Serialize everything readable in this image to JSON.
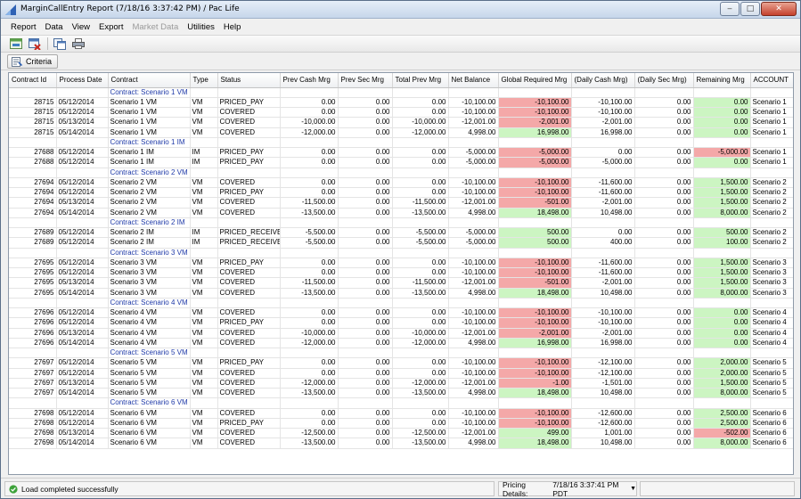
{
  "window": {
    "title": "MarginCallEntry Report (7/18/16 3:37:42 PM) / Pac Life",
    "controls": {
      "minimize": "‒",
      "maximize": "□",
      "close": "✕"
    }
  },
  "menu": [
    {
      "label": "Report",
      "enabled": true
    },
    {
      "label": "Data",
      "enabled": true
    },
    {
      "label": "View",
      "enabled": true
    },
    {
      "label": "Export",
      "enabled": true
    },
    {
      "label": "Market Data",
      "enabled": false
    },
    {
      "label": "Utilities",
      "enabled": true
    },
    {
      "label": "Help",
      "enabled": true
    }
  ],
  "criteria": {
    "label": "Criteria"
  },
  "table": {
    "columns": [
      "Contract Id",
      "Process Date",
      "Contract",
      "Type",
      "Status",
      "Prev Cash Mrg",
      "Prev Sec Mrg",
      "Total Prev Mrg",
      "Net Balance",
      "Global Required Mrg",
      "(Daily Cash Mrg)",
      "(Daily Sec Mrg)",
      "Remaining Mrg",
      "ACCOUNT"
    ],
    "rows": [
      {
        "group": "Contract: Scenario 1 VM"
      },
      {
        "id": "28715",
        "date": "05/12/2014",
        "contract": "Scenario 1 VM",
        "type": "VM",
        "status": "PRICED_PAY",
        "prevCash": "0.00",
        "prevSec": "0.00",
        "totalPrev": "0.00",
        "net": "-10,100.00",
        "globalReq": "-10,100.00",
        "dailyCash": "-10,100.00",
        "dailySec": "0.00",
        "remaining": "0.00",
        "account": "Scenario 1"
      },
      {
        "id": "28715",
        "date": "05/12/2014",
        "contract": "Scenario 1 VM",
        "type": "VM",
        "status": "COVERED",
        "prevCash": "0.00",
        "prevSec": "0.00",
        "totalPrev": "0.00",
        "net": "-10,100.00",
        "globalReq": "-10,100.00",
        "dailyCash": "-10,100.00",
        "dailySec": "0.00",
        "remaining": "0.00",
        "account": "Scenario 1"
      },
      {
        "id": "28715",
        "date": "05/13/2014",
        "contract": "Scenario 1 VM",
        "type": "VM",
        "status": "COVERED",
        "prevCash": "-10,000.00",
        "prevSec": "0.00",
        "totalPrev": "-10,000.00",
        "net": "-12,001.00",
        "globalReq": "-2,001.00",
        "dailyCash": "-2,001.00",
        "dailySec": "0.00",
        "remaining": "0.00",
        "account": "Scenario 1"
      },
      {
        "id": "28715",
        "date": "05/14/2014",
        "contract": "Scenario 1 VM",
        "type": "VM",
        "status": "COVERED",
        "prevCash": "-12,000.00",
        "prevSec": "0.00",
        "totalPrev": "-12,000.00",
        "net": "4,998.00",
        "globalReq": "16,998.00",
        "dailyCash": "16,998.00",
        "dailySec": "0.00",
        "remaining": "0.00",
        "account": "Scenario 1"
      },
      {
        "group": "Contract: Scenario 1 IM"
      },
      {
        "id": "27688",
        "date": "05/12/2014",
        "contract": "Scenario 1 IM",
        "type": "IM",
        "status": "PRICED_PAY",
        "prevCash": "0.00",
        "prevSec": "0.00",
        "totalPrev": "0.00",
        "net": "-5,000.00",
        "globalReq": "-5,000.00",
        "dailyCash": "0.00",
        "dailySec": "0.00",
        "remaining": "-5,000.00",
        "account": "Scenario 1"
      },
      {
        "id": "27688",
        "date": "05/12/2014",
        "contract": "Scenario 1 IM",
        "type": "IM",
        "status": "PRICED_PAY",
        "prevCash": "0.00",
        "prevSec": "0.00",
        "totalPrev": "0.00",
        "net": "-5,000.00",
        "globalReq": "-5,000.00",
        "dailyCash": "-5,000.00",
        "dailySec": "0.00",
        "remaining": "0.00",
        "account": "Scenario 1"
      },
      {
        "group": "Contract: Scenario 2 VM"
      },
      {
        "id": "27694",
        "date": "05/12/2014",
        "contract": "Scenario 2 VM",
        "type": "VM",
        "status": "COVERED",
        "prevCash": "0.00",
        "prevSec": "0.00",
        "totalPrev": "0.00",
        "net": "-10,100.00",
        "globalReq": "-10,100.00",
        "dailyCash": "-11,600.00",
        "dailySec": "0.00",
        "remaining": "1,500.00",
        "account": "Scenario 2"
      },
      {
        "id": "27694",
        "date": "05/12/2014",
        "contract": "Scenario 2 VM",
        "type": "VM",
        "status": "PRICED_PAY",
        "prevCash": "0.00",
        "prevSec": "0.00",
        "totalPrev": "0.00",
        "net": "-10,100.00",
        "globalReq": "-10,100.00",
        "dailyCash": "-11,600.00",
        "dailySec": "0.00",
        "remaining": "1,500.00",
        "account": "Scenario 2"
      },
      {
        "id": "27694",
        "date": "05/13/2014",
        "contract": "Scenario 2 VM",
        "type": "VM",
        "status": "COVERED",
        "prevCash": "-11,500.00",
        "prevSec": "0.00",
        "totalPrev": "-11,500.00",
        "net": "-12,001.00",
        "globalReq": "-501.00",
        "dailyCash": "-2,001.00",
        "dailySec": "0.00",
        "remaining": "1,500.00",
        "account": "Scenario 2"
      },
      {
        "id": "27694",
        "date": "05/14/2014",
        "contract": "Scenario 2 VM",
        "type": "VM",
        "status": "COVERED",
        "prevCash": "-13,500.00",
        "prevSec": "0.00",
        "totalPrev": "-13,500.00",
        "net": "4,998.00",
        "globalReq": "18,498.00",
        "dailyCash": "10,498.00",
        "dailySec": "0.00",
        "remaining": "8,000.00",
        "account": "Scenario 2"
      },
      {
        "group": "Contract: Scenario 2 IM"
      },
      {
        "id": "27689",
        "date": "05/12/2014",
        "contract": "Scenario 2 IM",
        "type": "IM",
        "status": "PRICED_RECEIVE",
        "prevCash": "-5,500.00",
        "prevSec": "0.00",
        "totalPrev": "-5,500.00",
        "net": "-5,000.00",
        "globalReq": "500.00",
        "dailyCash": "0.00",
        "dailySec": "0.00",
        "remaining": "500.00",
        "account": "Scenario 2"
      },
      {
        "id": "27689",
        "date": "05/12/2014",
        "contract": "Scenario 2 IM",
        "type": "IM",
        "status": "PRICED_RECEIVE",
        "prevCash": "-5,500.00",
        "prevSec": "0.00",
        "totalPrev": "-5,500.00",
        "net": "-5,000.00",
        "globalReq": "500.00",
        "dailyCash": "400.00",
        "dailySec": "0.00",
        "remaining": "100.00",
        "account": "Scenario 2"
      },
      {
        "group": "Contract: Scenario 3 VM"
      },
      {
        "id": "27695",
        "date": "05/12/2014",
        "contract": "Scenario 3 VM",
        "type": "VM",
        "status": "PRICED_PAY",
        "prevCash": "0.00",
        "prevSec": "0.00",
        "totalPrev": "0.00",
        "net": "-10,100.00",
        "globalReq": "-10,100.00",
        "dailyCash": "-11,600.00",
        "dailySec": "0.00",
        "remaining": "1,500.00",
        "account": "Scenario 3"
      },
      {
        "id": "27695",
        "date": "05/12/2014",
        "contract": "Scenario 3 VM",
        "type": "VM",
        "status": "COVERED",
        "prevCash": "0.00",
        "prevSec": "0.00",
        "totalPrev": "0.00",
        "net": "-10,100.00",
        "globalReq": "-10,100.00",
        "dailyCash": "-11,600.00",
        "dailySec": "0.00",
        "remaining": "1,500.00",
        "account": "Scenario 3"
      },
      {
        "id": "27695",
        "date": "05/13/2014",
        "contract": "Scenario 3 VM",
        "type": "VM",
        "status": "COVERED",
        "prevCash": "-11,500.00",
        "prevSec": "0.00",
        "totalPrev": "-11,500.00",
        "net": "-12,001.00",
        "globalReq": "-501.00",
        "dailyCash": "-2,001.00",
        "dailySec": "0.00",
        "remaining": "1,500.00",
        "account": "Scenario 3"
      },
      {
        "id": "27695",
        "date": "05/14/2014",
        "contract": "Scenario 3 VM",
        "type": "VM",
        "status": "COVERED",
        "prevCash": "-13,500.00",
        "prevSec": "0.00",
        "totalPrev": "-13,500.00",
        "net": "4,998.00",
        "globalReq": "18,498.00",
        "dailyCash": "10,498.00",
        "dailySec": "0.00",
        "remaining": "8,000.00",
        "account": "Scenario 3"
      },
      {
        "group": "Contract: Scenario 4 VM"
      },
      {
        "id": "27696",
        "date": "05/12/2014",
        "contract": "Scenario 4 VM",
        "type": "VM",
        "status": "COVERED",
        "prevCash": "0.00",
        "prevSec": "0.00",
        "totalPrev": "0.00",
        "net": "-10,100.00",
        "globalReq": "-10,100.00",
        "dailyCash": "-10,100.00",
        "dailySec": "0.00",
        "remaining": "0.00",
        "account": "Scenario 4"
      },
      {
        "id": "27696",
        "date": "05/12/2014",
        "contract": "Scenario 4 VM",
        "type": "VM",
        "status": "PRICED_PAY",
        "prevCash": "0.00",
        "prevSec": "0.00",
        "totalPrev": "0.00",
        "net": "-10,100.00",
        "globalReq": "-10,100.00",
        "dailyCash": "-10,100.00",
        "dailySec": "0.00",
        "remaining": "0.00",
        "account": "Scenario 4"
      },
      {
        "id": "27696",
        "date": "05/13/2014",
        "contract": "Scenario 4 VM",
        "type": "VM",
        "status": "COVERED",
        "prevCash": "-10,000.00",
        "prevSec": "0.00",
        "totalPrev": "-10,000.00",
        "net": "-12,001.00",
        "globalReq": "-2,001.00",
        "dailyCash": "-2,001.00",
        "dailySec": "0.00",
        "remaining": "0.00",
        "account": "Scenario 4"
      },
      {
        "id": "27696",
        "date": "05/14/2014",
        "contract": "Scenario 4 VM",
        "type": "VM",
        "status": "COVERED",
        "prevCash": "-12,000.00",
        "prevSec": "0.00",
        "totalPrev": "-12,000.00",
        "net": "4,998.00",
        "globalReq": "16,998.00",
        "dailyCash": "16,998.00",
        "dailySec": "0.00",
        "remaining": "0.00",
        "account": "Scenario 4"
      },
      {
        "group": "Contract: Scenario 5 VM"
      },
      {
        "id": "27697",
        "date": "05/12/2014",
        "contract": "Scenario 5 VM",
        "type": "VM",
        "status": "PRICED_PAY",
        "prevCash": "0.00",
        "prevSec": "0.00",
        "totalPrev": "0.00",
        "net": "-10,100.00",
        "globalReq": "-10,100.00",
        "dailyCash": "-12,100.00",
        "dailySec": "0.00",
        "remaining": "2,000.00",
        "account": "Scenario 5"
      },
      {
        "id": "27697",
        "date": "05/12/2014",
        "contract": "Scenario 5 VM",
        "type": "VM",
        "status": "COVERED",
        "prevCash": "0.00",
        "prevSec": "0.00",
        "totalPrev": "0.00",
        "net": "-10,100.00",
        "globalReq": "-10,100.00",
        "dailyCash": "-12,100.00",
        "dailySec": "0.00",
        "remaining": "2,000.00",
        "account": "Scenario 5"
      },
      {
        "id": "27697",
        "date": "05/13/2014",
        "contract": "Scenario 5 VM",
        "type": "VM",
        "status": "COVERED",
        "prevCash": "-12,000.00",
        "prevSec": "0.00",
        "totalPrev": "-12,000.00",
        "net": "-12,001.00",
        "globalReq": "-1.00",
        "dailyCash": "-1,501.00",
        "dailySec": "0.00",
        "remaining": "1,500.00",
        "account": "Scenario 5"
      },
      {
        "id": "27697",
        "date": "05/14/2014",
        "contract": "Scenario 5 VM",
        "type": "VM",
        "status": "COVERED",
        "prevCash": "-13,500.00",
        "prevSec": "0.00",
        "totalPrev": "-13,500.00",
        "net": "4,998.00",
        "globalReq": "18,498.00",
        "dailyCash": "10,498.00",
        "dailySec": "0.00",
        "remaining": "8,000.00",
        "account": "Scenario 5"
      },
      {
        "group": "Contract: Scenario 6 VM"
      },
      {
        "id": "27698",
        "date": "05/12/2014",
        "contract": "Scenario 6 VM",
        "type": "VM",
        "status": "COVERED",
        "prevCash": "0.00",
        "prevSec": "0.00",
        "totalPrev": "0.00",
        "net": "-10,100.00",
        "globalReq": "-10,100.00",
        "dailyCash": "-12,600.00",
        "dailySec": "0.00",
        "remaining": "2,500.00",
        "account": "Scenario 6"
      },
      {
        "id": "27698",
        "date": "05/12/2014",
        "contract": "Scenario 6 VM",
        "type": "VM",
        "status": "PRICED_PAY",
        "prevCash": "0.00",
        "prevSec": "0.00",
        "totalPrev": "0.00",
        "net": "-10,100.00",
        "globalReq": "-10,100.00",
        "dailyCash": "-12,600.00",
        "dailySec": "0.00",
        "remaining": "2,500.00",
        "account": "Scenario 6"
      },
      {
        "id": "27698",
        "date": "05/13/2014",
        "contract": "Scenario 6 VM",
        "type": "VM",
        "status": "COVERED",
        "prevCash": "-12,500.00",
        "prevSec": "0.00",
        "totalPrev": "-12,500.00",
        "net": "-12,001.00",
        "globalReq": "499.00",
        "dailyCash": "1,001.00",
        "dailySec": "0.00",
        "remaining": "-502.00",
        "account": "Scenario 6"
      },
      {
        "id": "27698",
        "date": "05/14/2014",
        "contract": "Scenario 6 VM",
        "type": "VM",
        "status": "COVERED",
        "prevCash": "-13,500.00",
        "prevSec": "0.00",
        "totalPrev": "-13,500.00",
        "net": "4,998.00",
        "globalReq": "18,498.00",
        "dailyCash": "10,498.00",
        "dailySec": "0.00",
        "remaining": "8,000.00",
        "account": "Scenario 6"
      }
    ]
  },
  "statusbar": {
    "message": "Load completed successfully",
    "pricing_label": "Pricing Details:",
    "pricing_value": "7/18/16 3:37:41 PM PDT"
  },
  "colors": {
    "negative_highlight": "#f4a8a8",
    "positive_highlight": "#ccf5c2",
    "group_text": "#1f3aa8",
    "title_gradient_top": "#e6eef8"
  },
  "icons": {
    "app": "report-app-icon",
    "toolbar": [
      "refresh-icon",
      "clear-icon",
      "copy-icon",
      "print-icon"
    ],
    "criteria": "criteria-icon",
    "status": "success-check-icon"
  }
}
